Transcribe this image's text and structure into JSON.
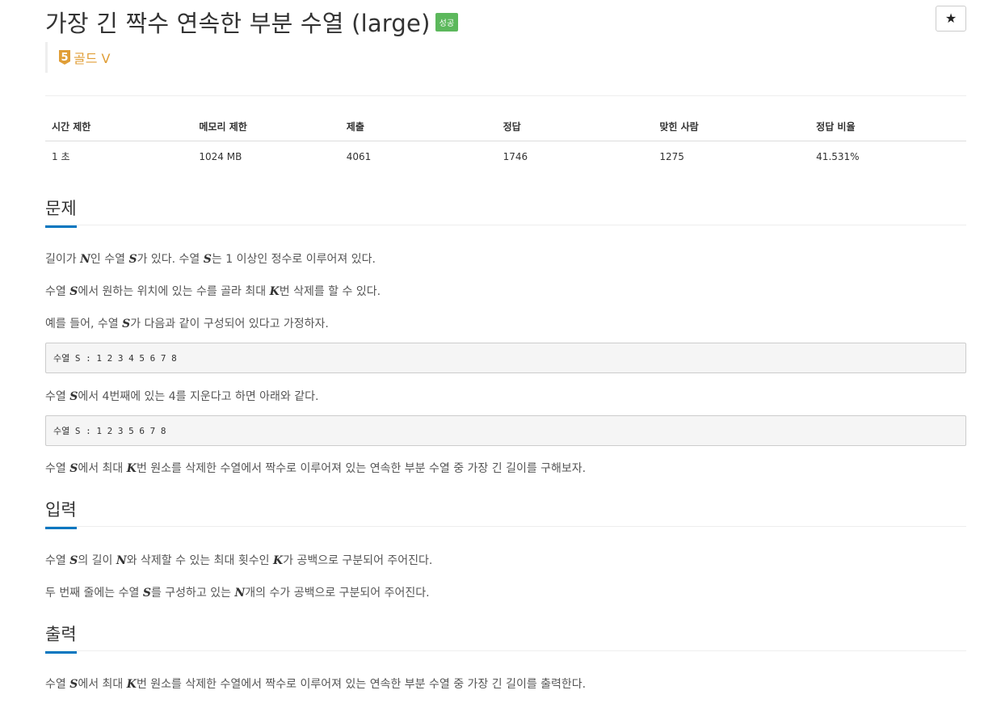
{
  "problem": {
    "title": "가장 긴 짝수 연속한 부분 수열 (large)",
    "status_badge": "성공",
    "star_icon": "★",
    "tier_number": "5",
    "tier_label": "골드 V",
    "colors": {
      "tier": "#e09e37",
      "success": "#5cb85c",
      "section_accent": "#0076c0"
    }
  },
  "stats": {
    "headers": [
      "시간 제한",
      "메모리 제한",
      "제출",
      "정답",
      "맞힌 사람",
      "정답 비율"
    ],
    "values": [
      "1 초",
      "1024 MB",
      "4061",
      "1746",
      "1275",
      "41.531%"
    ]
  },
  "sections": {
    "problem_heading": "문제",
    "input_heading": "입력",
    "output_heading": "출력"
  },
  "description": {
    "p1": [
      "길이가 ",
      "N",
      "인 수열 ",
      "S",
      "가 있다. 수열 ",
      "S",
      "는 1 이상인 정수로 이루어져 있다."
    ],
    "p2": [
      "수열 ",
      "S",
      "에서 원하는 위치에 있는 수를 골라 최대 ",
      "K",
      "번 삭제를 할 수 있다."
    ],
    "p3": [
      "예를 들어, 수열 ",
      "S",
      "가 다음과 같이 구성되어 있다고 가정하자."
    ],
    "code1": "수열 S : 1 2 3 4 5 6 7 8",
    "p4": [
      "수열 ",
      "S",
      "에서 4번째에 있는 4를 지운다고 하면 아래와 같다."
    ],
    "code2": "수열 S : 1 2 3 5 6 7 8",
    "p5": [
      "수열 ",
      "S",
      "에서 최대 ",
      "K",
      "번 원소를 삭제한 수열에서 짝수로 이루어져 있는 연속한 부분 수열 중 가장 긴 길이를 구해보자."
    ]
  },
  "input": {
    "p1": [
      "수열 ",
      "S",
      "의 길이 ",
      "N",
      "와 삭제할 수 있는 최대 횟수인 ",
      "K",
      "가 공백으로 구분되어 주어진다."
    ],
    "p2": [
      "두 번째 줄에는 수열 ",
      "S",
      "를 구성하고 있는 ",
      "N",
      "개의 수가 공백으로 구분되어 주어진다."
    ]
  },
  "output": {
    "p1": [
      "수열 ",
      "S",
      "에서 최대 ",
      "K",
      "번 원소를 삭제한 수열에서 짝수로 이루어져 있는 연속한 부분 수열 중 가장 긴 길이를 출력한다."
    ]
  }
}
